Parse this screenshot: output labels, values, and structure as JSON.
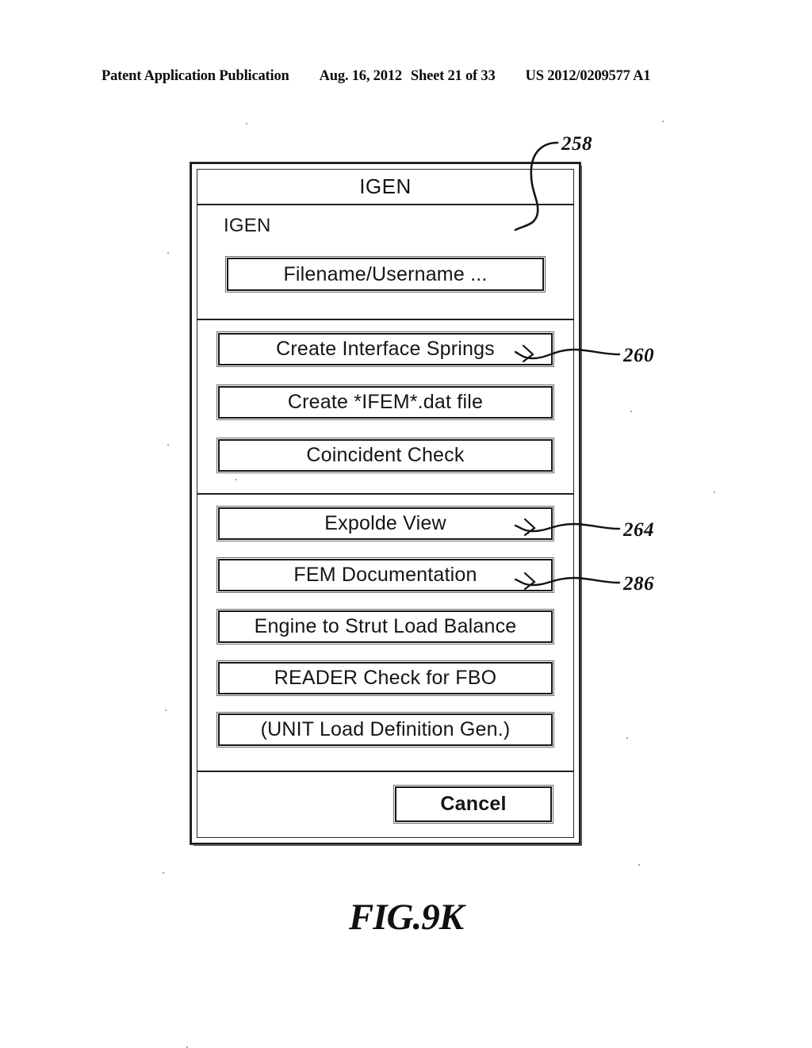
{
  "page_header": {
    "publication": "Patent Application Publication",
    "date": "Aug. 16, 2012",
    "sheet": "Sheet 21 of 33",
    "patent_number": "US 2012/0209577 A1"
  },
  "figure": {
    "caption": "FIG.9K"
  },
  "dialog": {
    "title": "IGEN",
    "label": "IGEN",
    "filename_button": "Filename/Username ...",
    "group1": [
      "Create Interface Springs",
      "Create *IFEM*.dat file",
      "Coincident Check"
    ],
    "group2": [
      "Expolde View",
      "FEM Documentation",
      "Engine to Strut Load Balance",
      "READER Check for FBO",
      "(UNIT Load Definition Gen.)"
    ],
    "cancel_button": "Cancel"
  },
  "reference_numerals": {
    "dialog": "258",
    "group1": "260",
    "explode_view": "264",
    "fem_documentation": "286"
  },
  "colors": {
    "ink": "#111111",
    "paper": "#ffffff"
  }
}
